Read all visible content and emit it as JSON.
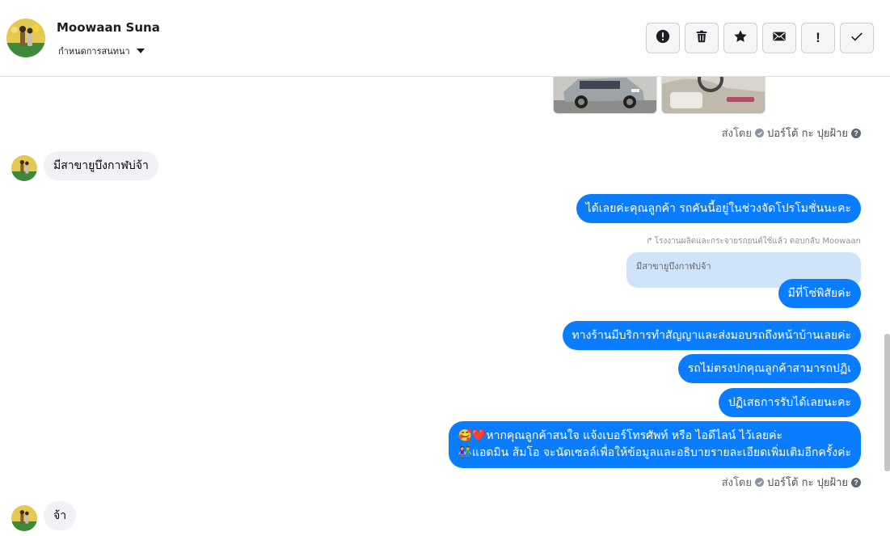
{
  "header": {
    "contact_name": "Moowaan Suna",
    "assign_label": "กำหนดการสนทนา",
    "toolbar": [
      {
        "name": "report-button",
        "icon": "alert-circle-icon"
      },
      {
        "name": "delete-button",
        "icon": "trash-icon"
      },
      {
        "name": "star-button",
        "icon": "star-icon"
      },
      {
        "name": "mark-unread-button",
        "icon": "envelope-icon"
      },
      {
        "name": "follow-up-button",
        "icon": "exclamation-icon"
      },
      {
        "name": "mark-done-button",
        "icon": "checkmark-icon"
      }
    ]
  },
  "conversation": {
    "sent_by_label": "ส่งโดย",
    "sender_name": "ปอร์โต้ กะ ปุยฝ้าย",
    "incoming_1": "มีสาขายูบึงกาฬบ่จ้า",
    "outgoing_1": "ได้เลยค่ะคุณลูกค้า รถคันนี้อยู่ในช่วงจัดโปรโมชั่นนะคะ",
    "reply_note": "โรงงานผลิตและกระจายรถยนต์ใช้แล้ว ตอบกลับ Moowaan",
    "quoted_text": "มีสาขายูบึงกาฬบ่จ้า",
    "outgoing_2": "มีที่โซ่พิสัยค่ะ",
    "outgoing_3": "ทางร้านมีบริการทำสัญญาและส่งมอบรถถึงหน้าบ้านเลยค่ะ",
    "outgoing_4": "รถไม่ตรงปกคุณลูกค้าสามารถปฏิเ",
    "outgoing_5": "ปฏิเสธการรับได้เลยนะคะ",
    "outgoing_6_line1": "🥰❤️หากคุณลูกค้าสนใจ แจ้งเบอร์โทรศัพท์ หรือ ไอดีไลน์  ไว้เลยค่ะ",
    "outgoing_6_line2": "👫แอดมิน ส้มโอ จะนัดเซลล์เพื่อให้ข้อมูลและอธิบายรายละเอียดเพิ่มเติมอีกครั้งค่ะ",
    "incoming_2": "จ้า"
  },
  "colors": {
    "accent": "#0a7cff",
    "incoming_bubble": "#f0f2f5",
    "quoted_bubble": "#cfe3fb"
  }
}
